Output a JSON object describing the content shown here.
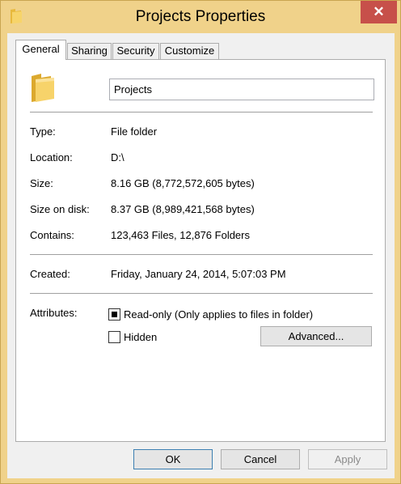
{
  "window": {
    "title": "Projects Properties",
    "close_label": "✕"
  },
  "tabs": [
    {
      "label": "General",
      "active": true
    },
    {
      "label": "Sharing",
      "active": false
    },
    {
      "label": "Security",
      "active": false
    },
    {
      "label": "Customize",
      "active": false
    }
  ],
  "general": {
    "folder_name": "Projects",
    "info": [
      {
        "label": "Type:",
        "value": "File folder"
      },
      {
        "label": "Location:",
        "value": "D:\\"
      },
      {
        "label": "Size:",
        "value": "8.16 GB (8,772,572,605 bytes)"
      },
      {
        "label": "Size on disk:",
        "value": "8.37 GB (8,989,421,568 bytes)"
      },
      {
        "label": "Contains:",
        "value": "123,463 Files, 12,876 Folders"
      }
    ],
    "created": {
      "label": "Created:",
      "value": "Friday, January 24, 2014, 5:07:03 PM"
    },
    "attributes": {
      "label": "Attributes:",
      "readonly_label": "Read-only (Only applies to files in folder)",
      "readonly_state": "indeterminate",
      "hidden_label": "Hidden",
      "hidden_checked": false,
      "advanced_label": "Advanced..."
    }
  },
  "buttons": {
    "ok": "OK",
    "cancel": "Cancel",
    "apply": "Apply",
    "apply_enabled": false
  },
  "colors": {
    "frame": "#f0d28a",
    "close": "#c7504a",
    "folder": "#f5c342"
  }
}
